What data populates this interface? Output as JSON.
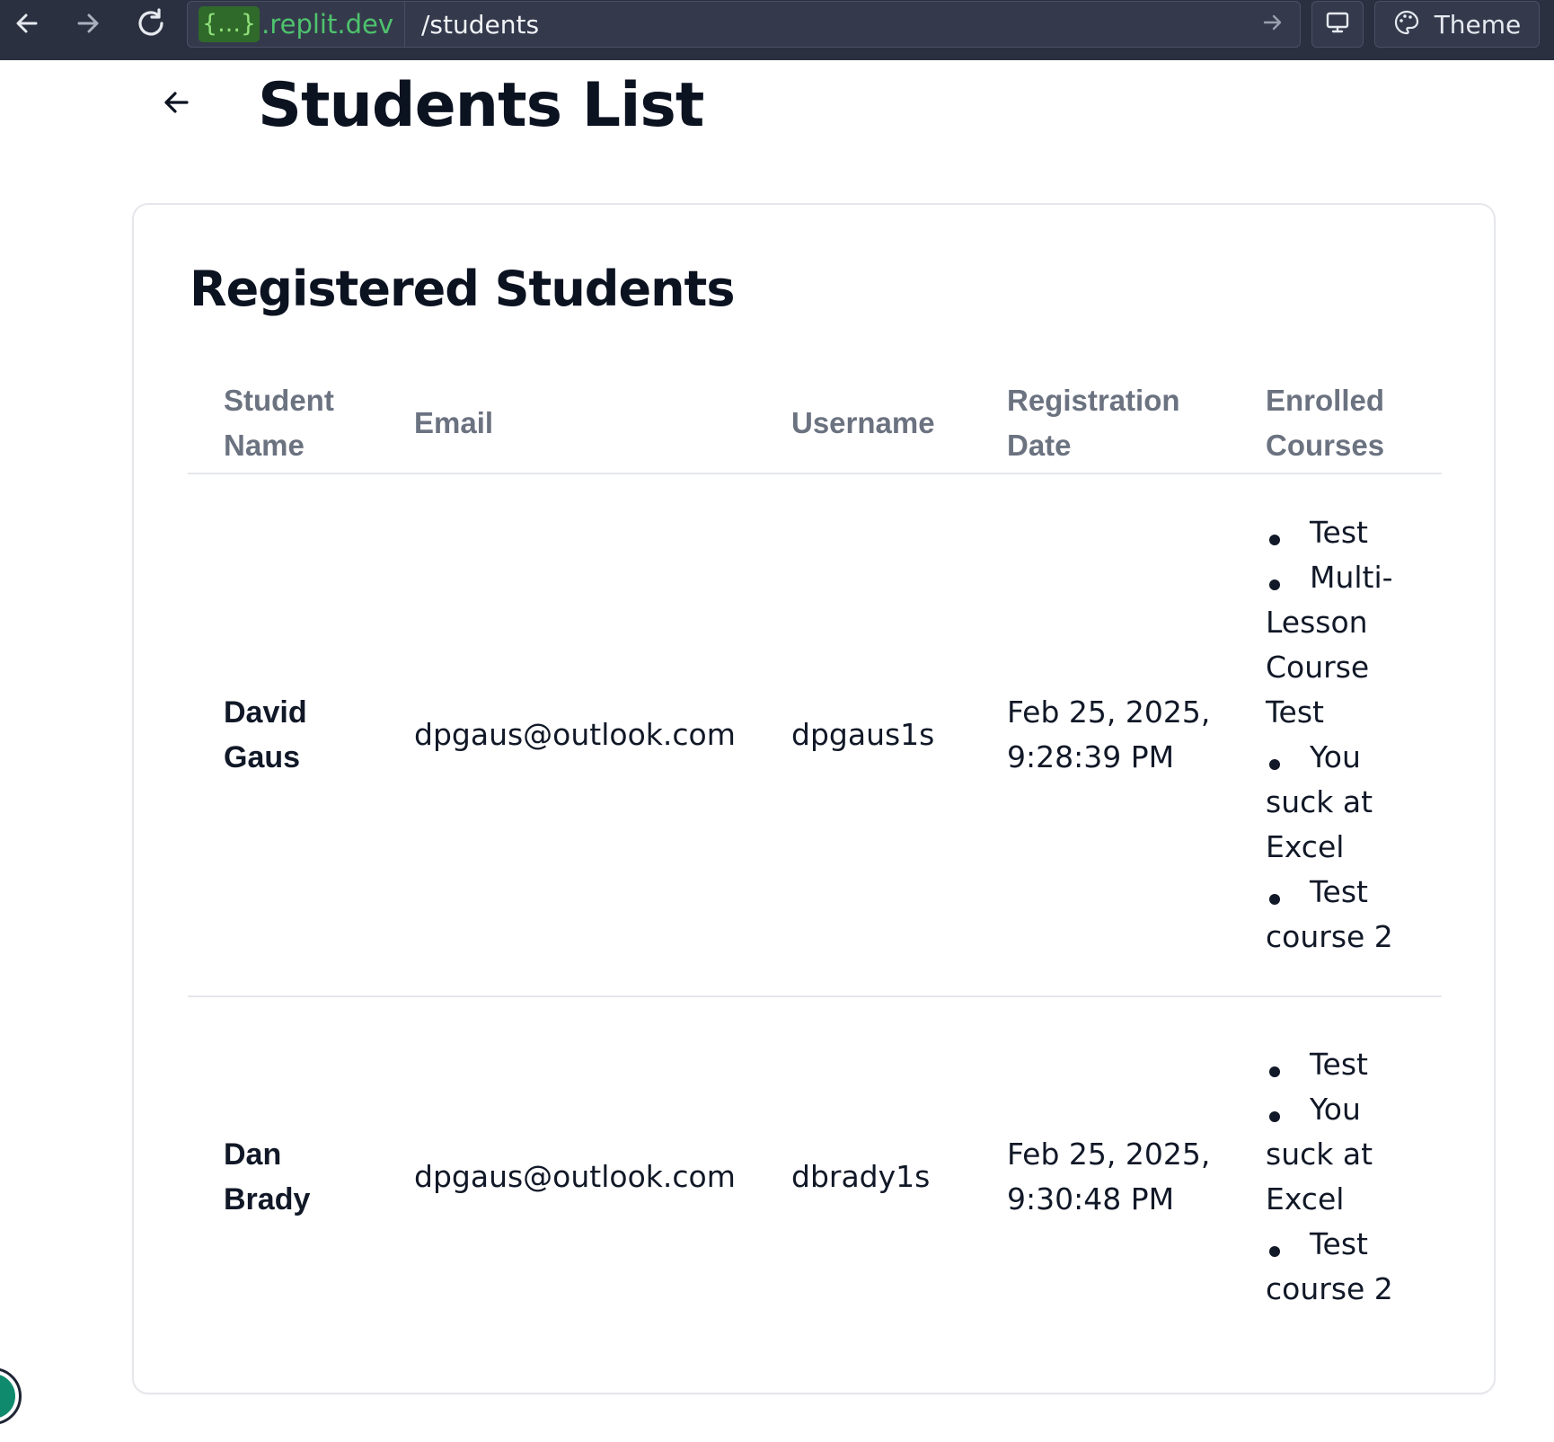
{
  "browser": {
    "url_badge": "{...}",
    "url_domain": ".replit.dev",
    "url_path": "/students",
    "theme_label": "Theme"
  },
  "page": {
    "title": "Students List"
  },
  "card": {
    "title": "Registered Students",
    "columns": [
      "Student Name",
      "Email",
      "Username",
      "Registration Date",
      "Enrolled Courses"
    ],
    "rows": [
      {
        "name": "David Gaus",
        "email": "dpgaus@outlook.com",
        "username": "dpgaus1s",
        "registered": "Feb 25, 2025, 9:28:39 PM",
        "courses": [
          "Test",
          "Multi-Lesson Course Test",
          "You suck at Excel",
          "Test course 2"
        ]
      },
      {
        "name": "Dan Brady",
        "email": "dpgaus@outlook.com",
        "username": "dbrady1s",
        "registered": "Feb 25, 2025, 9:30:48 PM",
        "courses": [
          "Test",
          "You suck at Excel",
          "Test course 2"
        ]
      }
    ]
  },
  "icons": {
    "back": "arrow-left-icon",
    "forward": "arrow-right-icon",
    "reload": "reload-icon",
    "go": "arrow-right-icon",
    "devtools": "monitor-icon",
    "theme": "palette-icon"
  },
  "colors": {
    "toolbar_bg": "#2b3040",
    "url_domain": "#4ec36d",
    "header_text": "#6b7280",
    "body_text": "#111827",
    "widget_accent": "#0f8a6c"
  }
}
